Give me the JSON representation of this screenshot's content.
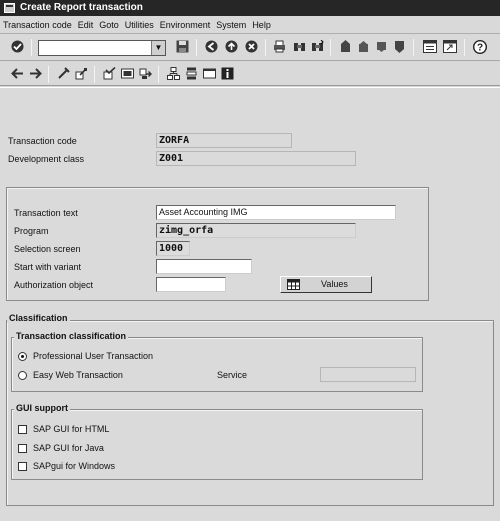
{
  "window": {
    "title": "Create Report transaction"
  },
  "menu": [
    "Transaction code",
    "Edit",
    "Goto",
    "Utilities",
    "Environment",
    "System",
    "Help"
  ],
  "toolbar": {
    "command_field_value": "",
    "icons1": [
      "enter-icon",
      "save-icon",
      "back-icon",
      "exit-icon",
      "cancel-icon",
      "print-icon",
      "find-icon",
      "find-next-icon",
      "first-page-icon",
      "previous-page-icon",
      "next-page-icon",
      "last-page-icon",
      "create-session-icon",
      "shortcut-icon",
      "help-icon"
    ],
    "icons2": [
      "previous-object-icon",
      "next-object-icon",
      "other-object-icon",
      "display-change-icon",
      "check-icon",
      "activate-icon",
      "test-icon",
      "object-list-icon",
      "where-used-icon",
      "display-object-icon",
      "information-icon"
    ]
  },
  "header_fields": {
    "transaction_code_label": "Transaction code",
    "transaction_code_value": "ZORFA",
    "development_class_label": "Development class",
    "development_class_value": "Z001"
  },
  "details": {
    "transaction_text_label": "Transaction text",
    "transaction_text_value": "Asset Accounting IMG",
    "program_label": "Program",
    "program_value": "zimg_orfa",
    "selection_screen_label": "Selection screen",
    "selection_screen_value": "1000",
    "start_with_variant_label": "Start with variant",
    "start_with_variant_value": "",
    "authorization_object_label": "Authorization object",
    "authorization_object_value": "",
    "values_button_label": "Values"
  },
  "classification": {
    "title": "Classification",
    "transaction_classification_title": "Transaction classification",
    "options": [
      {
        "label": "Professional User Transaction",
        "selected": true
      },
      {
        "label": "Easy Web Transaction",
        "selected": false
      }
    ],
    "service_label": "Service",
    "service_value": "",
    "gui_support_title": "GUI support",
    "gui_options": [
      {
        "label": "SAP GUI for HTML",
        "checked": false
      },
      {
        "label": "SAP GUI for Java",
        "checked": false
      },
      {
        "label": "SAPgui for Windows",
        "checked": false
      }
    ]
  }
}
